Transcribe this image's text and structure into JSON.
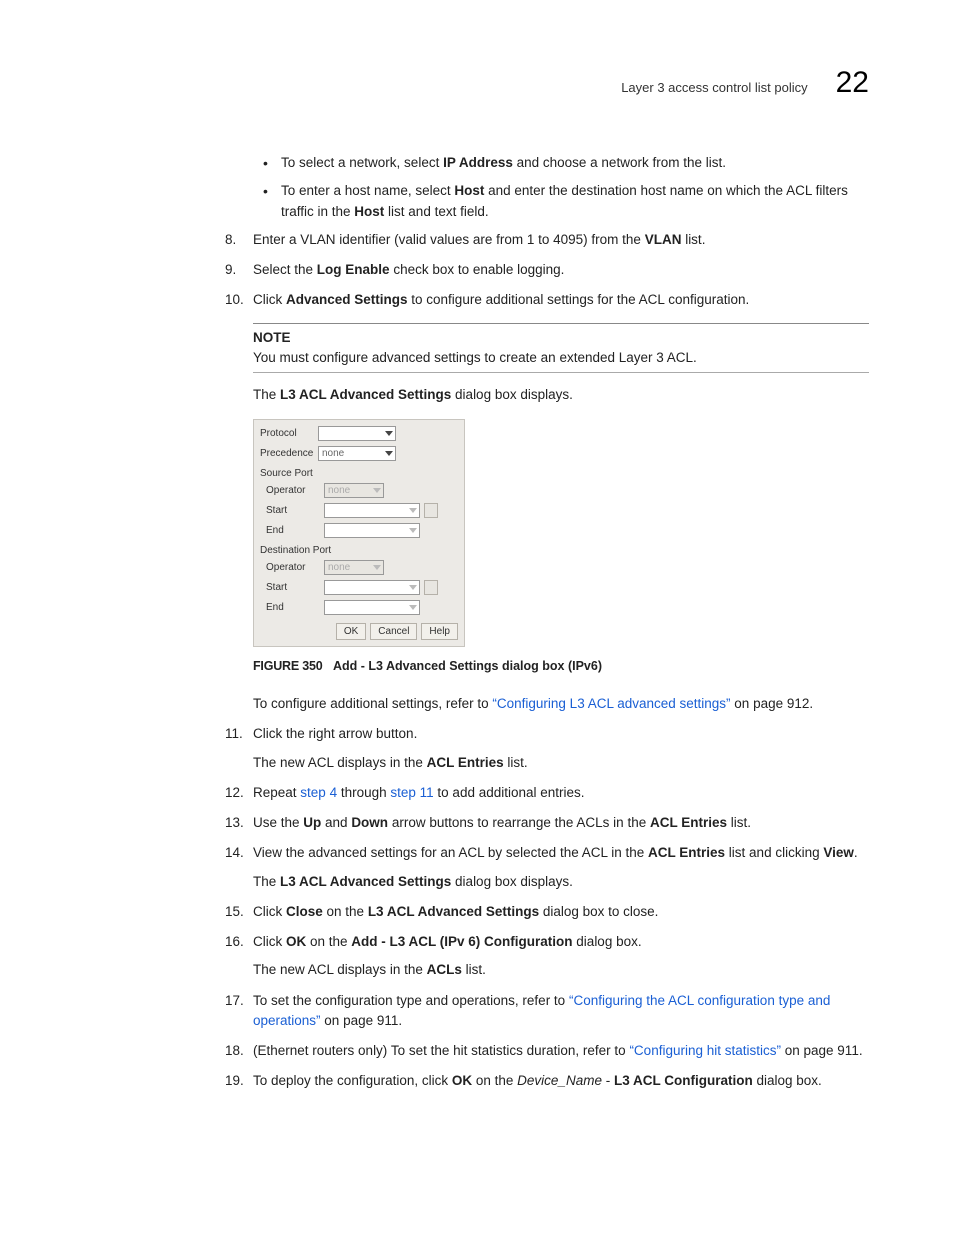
{
  "header": {
    "title": "Layer 3 access control list policy",
    "chapter_num": "22"
  },
  "bullets": {
    "b1a": "To select a network, select ",
    "b1b": "IP Address",
    "b1c": " and choose a network from the list.",
    "b2a": "To enter a host name, select ",
    "b2b": "Host",
    "b2c": " and enter the destination host name on which the ACL filters traffic in the ",
    "b2d": "Host",
    "b2e": " list and text field."
  },
  "steps": {
    "s8": {
      "num": "8.",
      "a": "Enter a VLAN identifier (valid values are from 1 to 4095) from the ",
      "b": "VLAN",
      "c": " list."
    },
    "s9": {
      "num": "9.",
      "a": "Select the ",
      "b": "Log Enable",
      "c": " check box to enable logging."
    },
    "s10": {
      "num": "10.",
      "a": "Click ",
      "b": "Advanced Settings",
      "c": " to configure additional settings for the ACL configuration."
    },
    "note": {
      "title": "NOTE",
      "body": "You must configure advanced settings to create an extended Layer 3 ACL."
    },
    "s10post": {
      "a": "The ",
      "b": "L3 ACL Advanced Settings",
      "c": " dialog box displays."
    },
    "figure": {
      "num": "FIGURE 350",
      "caption": "Add - L3 Advanced Settings dialog box (IPv6)"
    },
    "config_add": {
      "a": "To configure additional settings, refer to ",
      "link": "“Configuring L3 ACL advanced settings”",
      "c": " on page 912."
    },
    "s11": {
      "num": "11.",
      "a": "Click the right arrow button."
    },
    "s11post": {
      "a": "The new ACL displays in the ",
      "b": "ACL Entries",
      "c": " list."
    },
    "s12": {
      "num": "12.",
      "a": "Repeat ",
      "link1": "step 4",
      "b": " through ",
      "link2": "step 11",
      "c": " to add additional entries."
    },
    "s13": {
      "num": "13.",
      "a": "Use the ",
      "b": "Up",
      "c": " and ",
      "d": "Down",
      "e": " arrow buttons to rearrange the ACLs in the ",
      "f": "ACL Entries",
      "g": " list."
    },
    "s14": {
      "num": "14.",
      "a": "View the advanced settings for an ACL by selected the ACL in the ",
      "b": "ACL Entries",
      "c": " list and clicking ",
      "d": "View",
      "e": "."
    },
    "s14post": {
      "a": "The ",
      "b": "L3 ACL Advanced Settings",
      "c": " dialog box displays."
    },
    "s15": {
      "num": "15.",
      "a": "Click ",
      "b": "Close",
      "c": " on the ",
      "d": "L3 ACL Advanced Settings",
      "e": " dialog box to close."
    },
    "s16": {
      "num": "16.",
      "a": "Click ",
      "b": "OK",
      "c": " on the ",
      "d": "Add - L3 ACL (IPv 6) Configuration",
      "e": " dialog box."
    },
    "s16post": {
      "a": "The new ACL displays in the ",
      "b": "ACLs",
      "c": " list."
    },
    "s17": {
      "num": "17.",
      "a": "To set the configuration type and operations, refer to ",
      "link": "“Configuring the ACL configuration type and operations”",
      "c": " on page 911."
    },
    "s18": {
      "num": "18.",
      "a": "(Ethernet routers only) To set the hit statistics duration, refer to ",
      "link": "“Configuring hit statistics”",
      "c": " on page 911."
    },
    "s19": {
      "num": "19.",
      "a": "To deploy the configuration, click ",
      "b": "OK",
      "c": " on the ",
      "d": "Device_Name",
      "e": " - ",
      "f": "L3 ACL Configuration",
      "g": " dialog box."
    }
  },
  "dialog": {
    "protocol": "Protocol",
    "precedence": "Precedence",
    "precedence_val": "none",
    "source_port": "Source Port",
    "operator": "Operator",
    "operator_val": "none",
    "start": "Start",
    "end": "End",
    "dest_port": "Destination Port",
    "ok": "OK",
    "cancel": "Cancel",
    "help": "Help"
  }
}
